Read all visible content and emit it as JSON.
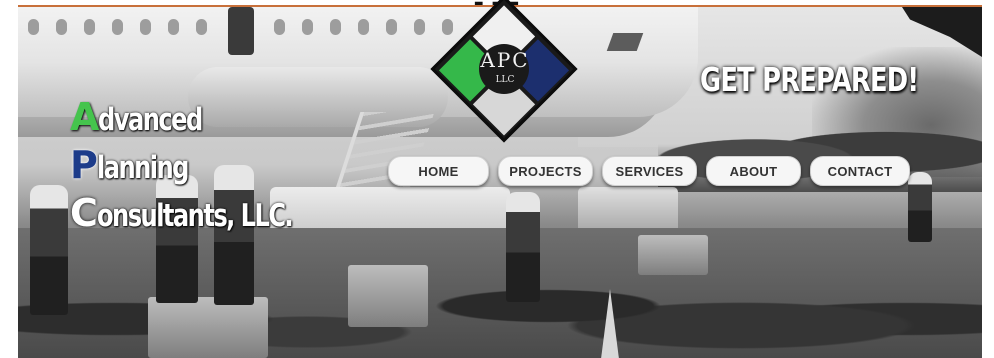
{
  "page": {
    "top_heading": "...",
    "accent_color": "#c8703a"
  },
  "logo": {
    "text": "APC",
    "sub": "LLC",
    "colors": {
      "green": "#35b84a",
      "navy": "#1c2f6e",
      "white": "#f0f0f0",
      "black": "#1a1a1a"
    }
  },
  "company": {
    "lines": [
      {
        "initial": "A",
        "rest": "dvanced"
      },
      {
        "initial": "P",
        "rest": "lanning"
      },
      {
        "initial": "C",
        "rest": "onsultants, LLC."
      }
    ]
  },
  "tagline": "GET PREPARED!",
  "nav": {
    "items": [
      {
        "label": "HOME"
      },
      {
        "label": "PROJECTS"
      },
      {
        "label": "SERVICES"
      },
      {
        "label": "ABOUT"
      },
      {
        "label": "CONTACT"
      }
    ]
  }
}
